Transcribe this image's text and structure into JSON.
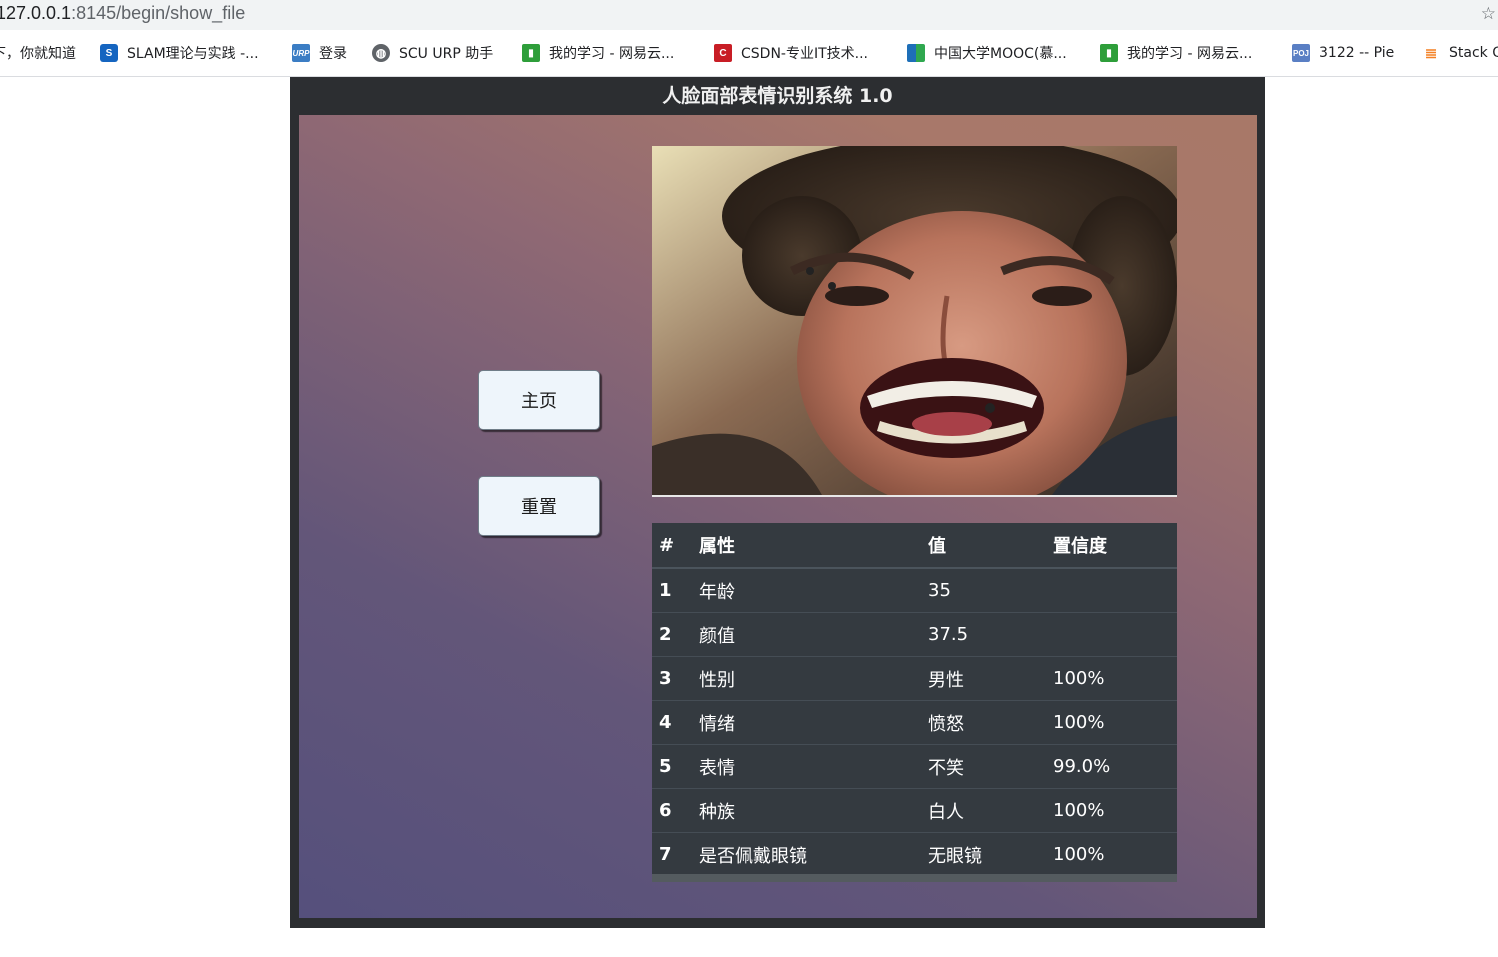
{
  "browser": {
    "url_host": "127.0.0.1",
    "url_path": ":8145/begin/show_file",
    "bookmarks": [
      {
        "icon": "text-cutoff",
        "label": "下，你就知道"
      },
      {
        "icon": "dollar-s-icon",
        "label": "SLAM理论与实践 -..."
      },
      {
        "icon": "urp-icon",
        "label": "登录"
      },
      {
        "icon": "globe-icon",
        "label": "SCU URP 助手"
      },
      {
        "icon": "netease-study-icon",
        "label": "我的学习 - 网易云..."
      },
      {
        "icon": "csdn-icon",
        "label": "CSDN-专业IT技术..."
      },
      {
        "icon": "mooc-icon",
        "label": "中国大学MOOC(慕..."
      },
      {
        "icon": "netease-study-icon",
        "label": "我的学习 - 网易云..."
      },
      {
        "icon": "poj-icon",
        "label": "3122 -- Pie"
      },
      {
        "icon": "stackoverflow-icon",
        "label": "Stack O"
      }
    ]
  },
  "app": {
    "title": "人脸面部表情识别系统 1.0",
    "buttons": {
      "home": "主页",
      "reset": "重置"
    },
    "table": {
      "headers": [
        "#",
        "属性",
        "值",
        "置信度"
      ],
      "rows": [
        {
          "num": "1",
          "attr": "年龄",
          "value": "35",
          "confidence": ""
        },
        {
          "num": "2",
          "attr": "颜值",
          "value": "37.5",
          "confidence": ""
        },
        {
          "num": "3",
          "attr": "性别",
          "value": "男性",
          "confidence": "100%"
        },
        {
          "num": "4",
          "attr": "情绪",
          "value": "愤怒",
          "confidence": "100%"
        },
        {
          "num": "5",
          "attr": "表情",
          "value": "不笑",
          "confidence": "99.0%"
        },
        {
          "num": "6",
          "attr": "种族",
          "value": "白人",
          "confidence": "100%"
        },
        {
          "num": "7",
          "attr": "是否佩戴眼镜",
          "value": "无眼镜",
          "confidence": "100%"
        }
      ]
    }
  },
  "colors": {
    "app_frame": "#2c2e31",
    "table_bg": "#343a40",
    "button_bg": "#eef5fb"
  }
}
